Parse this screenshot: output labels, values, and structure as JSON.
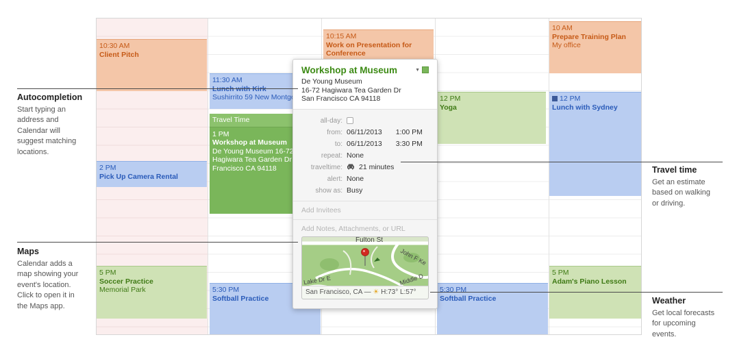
{
  "colors": {
    "orange": "#f4c6a8",
    "blue": "#b9cdf1",
    "green": "#cfe2b5",
    "selected_green": "#7ab65a",
    "weekend": "#fbeeee"
  },
  "calendar": {
    "events": {
      "client_pitch": {
        "time": "10:30 AM",
        "title": "Client Pitch"
      },
      "pickup": {
        "time": "2 PM",
        "title": "Pick Up Camera Rental"
      },
      "soccer": {
        "time": "5 PM",
        "title": "Soccer Practice",
        "location": "Memorial Park"
      },
      "lunch_kirk": {
        "time": "11:30 AM",
        "title": "Lunch with Kirk",
        "location": "Sushirrito 59 New Montgo"
      },
      "workshop": {
        "travel": "Travel Time",
        "time": "1 PM",
        "title": "Workshop at Museum",
        "location1": "De Young Museum 16-72",
        "location2": "Hagiwara Tea Garden Dr",
        "location3": "Francisco CA 94118"
      },
      "softball1": {
        "time": "5:30 PM",
        "title": "Softball Practice"
      },
      "presentation": {
        "time": "10:15 AM",
        "title1": "Work on Presentation for",
        "title2": "Conference"
      },
      "yoga": {
        "time": "12 PM",
        "title": "Yoga"
      },
      "softball2": {
        "time": "5:30 PM",
        "title": "Softball Practice"
      },
      "training": {
        "time": "10 AM",
        "title": "Prepare Training Plan",
        "location": "My office"
      },
      "lunch_sydney": {
        "time": "12 PM",
        "title": "Lunch with Sydney"
      },
      "piano": {
        "time": "5 PM",
        "title": "Adam's Piano Lesson"
      }
    }
  },
  "popover": {
    "title": "Workshop at Museum",
    "location_name": "De Young Museum",
    "address1": "16-72 Hagiwara Tea Garden Dr",
    "address2": "San Francisco CA 94118",
    "labels": {
      "allday": "all-day:",
      "from": "from:",
      "to": "to:",
      "repeat": "repeat:",
      "traveltime": "traveltime:",
      "alert": "alert:",
      "showas": "show as:"
    },
    "from_date": "06/11/2013",
    "from_time": "1:00 PM",
    "to_date": "06/11/2013",
    "to_time": "3:30 PM",
    "repeat": "None",
    "traveltime": "21 minutes",
    "alert": "None",
    "showas": "Busy",
    "add_invitees": "Add Invitees",
    "add_notes": "Add Notes, Attachments, or URL",
    "map": {
      "street1": "Fulton St",
      "street2": "John F Ke",
      "street3": "Middle D",
      "street4": "Lake Dr E",
      "weather_location": "San Francisco, CA —",
      "weather_temp": "H:73° L:57°"
    }
  },
  "callouts": {
    "autocompletion": {
      "heading": "Autocompletion",
      "body1": "Start typing an",
      "body2": "address and",
      "body3": "Calendar will",
      "body4": "suggest matching",
      "body5": "locations."
    },
    "maps": {
      "heading": "Maps",
      "body1": "Calendar adds a",
      "body2": "map showing your",
      "body3": "event's location.",
      "body4": "Click to open it in",
      "body5": "the Maps app."
    },
    "travel": {
      "heading": "Travel time",
      "body1": "Get an estimate",
      "body2": "based on walking",
      "body3": "or driving."
    },
    "weather": {
      "heading": "Weather",
      "body1": "Get local forecasts",
      "body2": "for upcoming",
      "body3": "events."
    }
  }
}
